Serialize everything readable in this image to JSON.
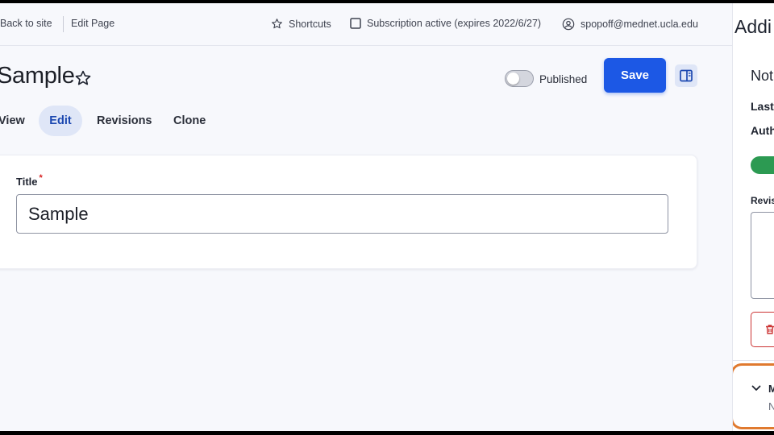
{
  "toolbar": {
    "back_label": "Back to site",
    "edit_label": "Edit Page",
    "shortcuts_label": "Shortcuts",
    "subscription_label": "Subscription active (expires 2022/6/27)",
    "user_label": "spopoff@mednet.ucla.edu",
    "icons": [
      "back-arrow-icon",
      "star-outline-icon",
      "checkbox-icon",
      "user-circle-icon"
    ]
  },
  "header": {
    "title": "Sample",
    "published_label": "Published",
    "published_on": false,
    "save_label": "Save"
  },
  "tabs": [
    {
      "label": "View",
      "active": false
    },
    {
      "label": "Edit",
      "active": true
    },
    {
      "label": "Revisions",
      "active": false
    },
    {
      "label": "Clone",
      "active": false
    }
  ],
  "form": {
    "title_label": "Title",
    "required_mark": "*",
    "title_value": "Sample"
  },
  "sidebar": {
    "heading": "Addi",
    "status": "Not",
    "last": "Last",
    "auth": "Auth",
    "revision": "Revis",
    "menu_label": "M",
    "menu_sub": "N"
  },
  "colors": {
    "accent": "#1c58e5",
    "active_tab_bg": "#dfe6f7",
    "active_tab_text": "#1b47b0",
    "switch_on": "#2c9a52",
    "delete": "#cc3333",
    "highlight_outline": "#e07a2f",
    "required": "#d72222"
  }
}
